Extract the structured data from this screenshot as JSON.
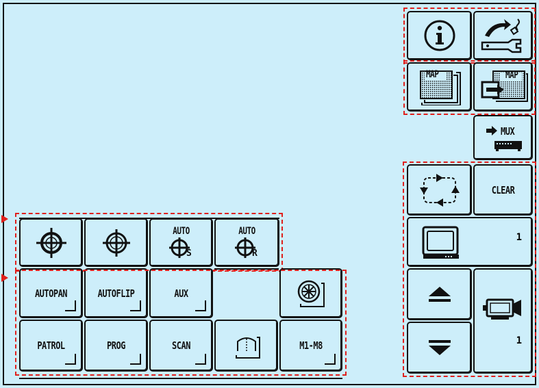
{
  "top_right": {
    "info_icon": "info-icon",
    "settings_icon": "wrench-settings-icon"
  },
  "map": {
    "map1_label": "MAP",
    "map2_label": "MAP"
  },
  "mux": {
    "label": "MUX"
  },
  "monitor": {
    "clear_label": "CLEAR",
    "monitor_number": "1",
    "camera_number": "1"
  },
  "preset_row": {
    "auto_s_label": "AUTO",
    "auto_r_label": "AUTO",
    "auto_s_suffix": "S",
    "auto_r_suffix": "R"
  },
  "func_row1": {
    "autopan": "AUTOPAN",
    "autoflip": "AUTOFLIP",
    "aux": "AUX"
  },
  "func_row2": {
    "patrol": "PATROL",
    "prog": "PROG",
    "scan": "SCAN",
    "m1m8": "M1-M8"
  },
  "colors": {
    "background": "#cdeefa",
    "outline": "#111111",
    "highlight": "#e0201c"
  }
}
